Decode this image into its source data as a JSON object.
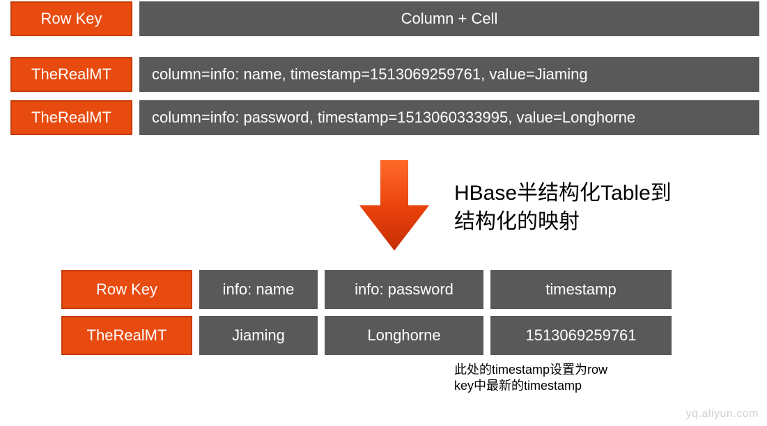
{
  "header": {
    "rowkey_label": "Row Key",
    "colcell_label": "Column + Cell"
  },
  "rows": [
    {
      "key": "TheRealMT",
      "content": "column=info: name, timestamp=1513069259761, value=Jiaming"
    },
    {
      "key": "TheRealMT",
      "content": "column=info: password, timestamp=1513060333995, value=Longhorne"
    }
  ],
  "caption_line1": "HBase半结构化Table到",
  "caption_line2": "结构化的映射",
  "table": {
    "header": {
      "rowkey": "Row Key",
      "col1": "info: name",
      "col2": "info: password",
      "col3": "timestamp"
    },
    "data": {
      "rowkey": "TheRealMT",
      "col1": "Jiaming",
      "col2": "Longhorne",
      "col3": "1513069259761"
    }
  },
  "footnote_line1": "此处的timestamp设置为row",
  "footnote_line2": "key中最新的timestamp",
  "watermark": "yq.aliyun.com"
}
